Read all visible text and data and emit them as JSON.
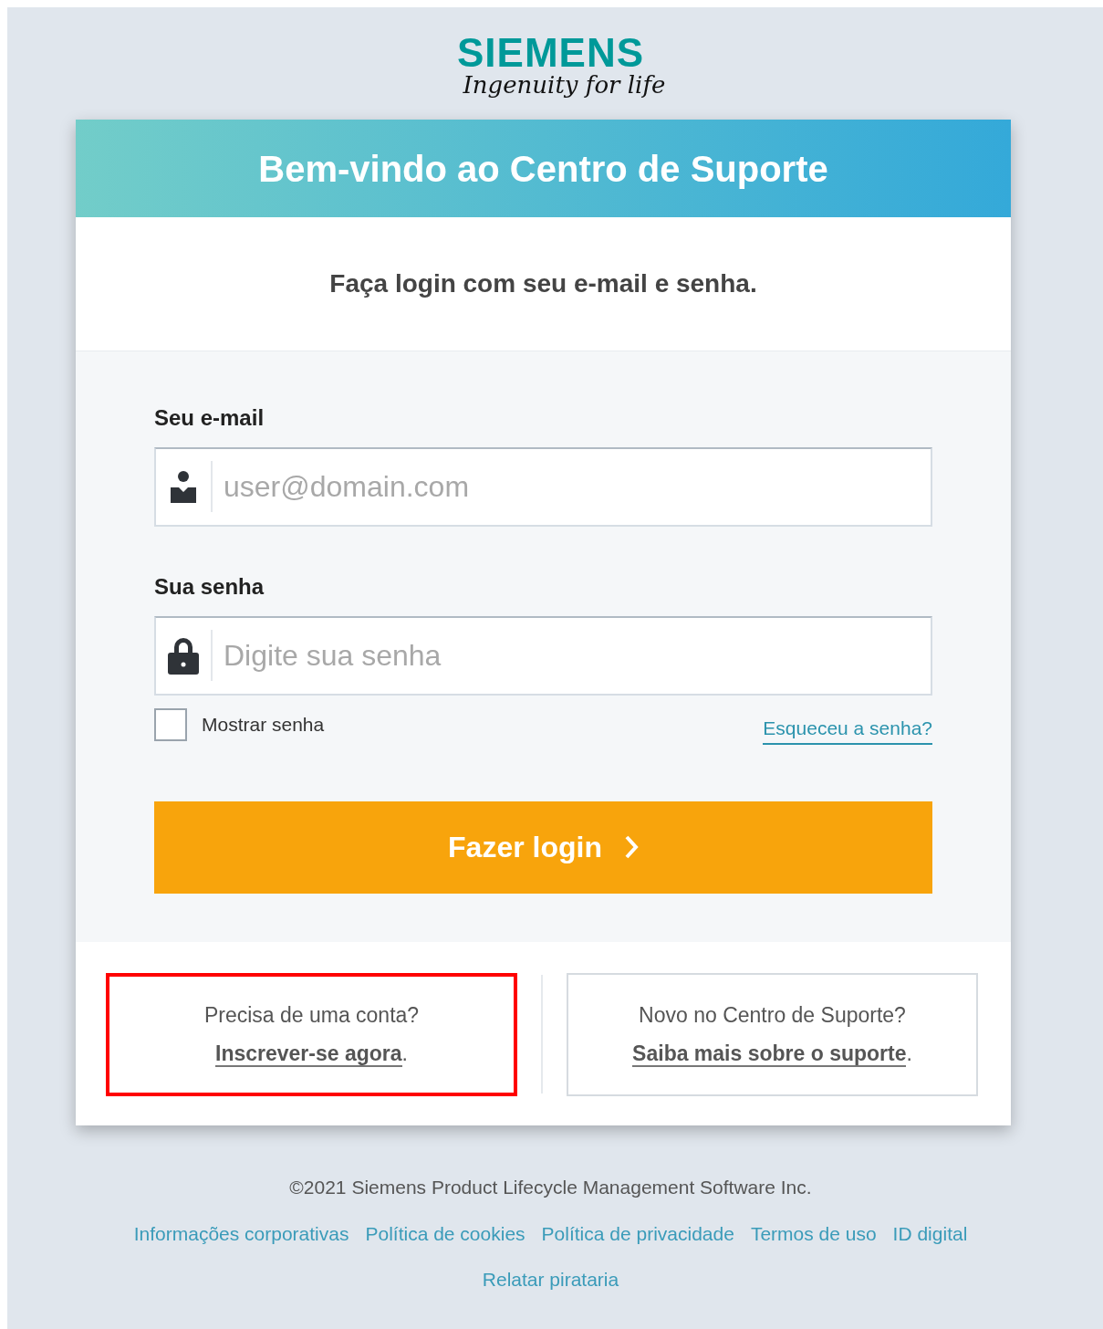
{
  "logo": {
    "wordmark": "SIEMENS",
    "tagline": "Ingenuity for life"
  },
  "header": {
    "title": "Bem-vindo ao Centro de Suporte"
  },
  "intro": "Faça login com seu e-mail e senha.",
  "fields": [
    {
      "kind": "email",
      "label": "Seu e-mail",
      "placeholder": "user@domain.com"
    },
    {
      "kind": "password",
      "label": "Sua senha",
      "placeholder": "Digite sua senha"
    }
  ],
  "show_password": {
    "label": "Mostrar senha",
    "checked": false
  },
  "forgot_link": "Esqueceu a senha?",
  "login_button": {
    "label": "Fazer login"
  },
  "info_boxes": [
    {
      "question": "Precisa de uma conta?",
      "link": "Inscrever-se agora",
      "suffix": ".",
      "highlighted": true
    },
    {
      "question": "Novo no Centro de Suporte?",
      "link": "Saiba mais sobre o suporte",
      "suffix": ".",
      "highlighted": false
    }
  ],
  "footer": {
    "copyright": "©2021 Siemens Product Lifecycle Management Software Inc.",
    "links": [
      "Informações corporativas",
      "Política de cookies",
      "Política de privacidade",
      "Termos de uso",
      "ID digital",
      "Relatar pirataria"
    ]
  }
}
